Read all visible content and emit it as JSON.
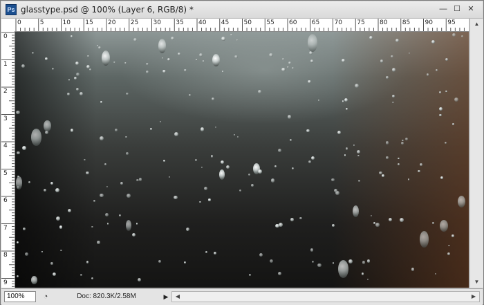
{
  "window": {
    "app_icon_text": "Ps",
    "title": "glasstype.psd @ 100% (Layer 6, RGB/8) *",
    "minimize_glyph": "—",
    "maximize_glyph": "☐",
    "close_glyph": "✕"
  },
  "ruler_h": {
    "labels": [
      "0",
      "5",
      "10",
      "15",
      "20",
      "25",
      "30",
      "35",
      "40",
      "45",
      "50",
      "55",
      "60",
      "65",
      "70",
      "75",
      "80",
      "85",
      "90",
      "95"
    ]
  },
  "ruler_v": {
    "labels": [
      "0",
      "1",
      "2",
      "3",
      "4",
      "5",
      "6",
      "7",
      "8",
      "9"
    ]
  },
  "canvas": {
    "content": "rain-on-glass-texture"
  },
  "scrollbar_v": {
    "up_glyph": "▲",
    "down_glyph": "▼"
  },
  "status": {
    "zoom": "100%",
    "icon": "status-menu-icon",
    "doc_info": "Doc: 820.3K/2.58M",
    "arrow": "▶",
    "left_glyph": "◀",
    "right_glyph": "▶"
  }
}
